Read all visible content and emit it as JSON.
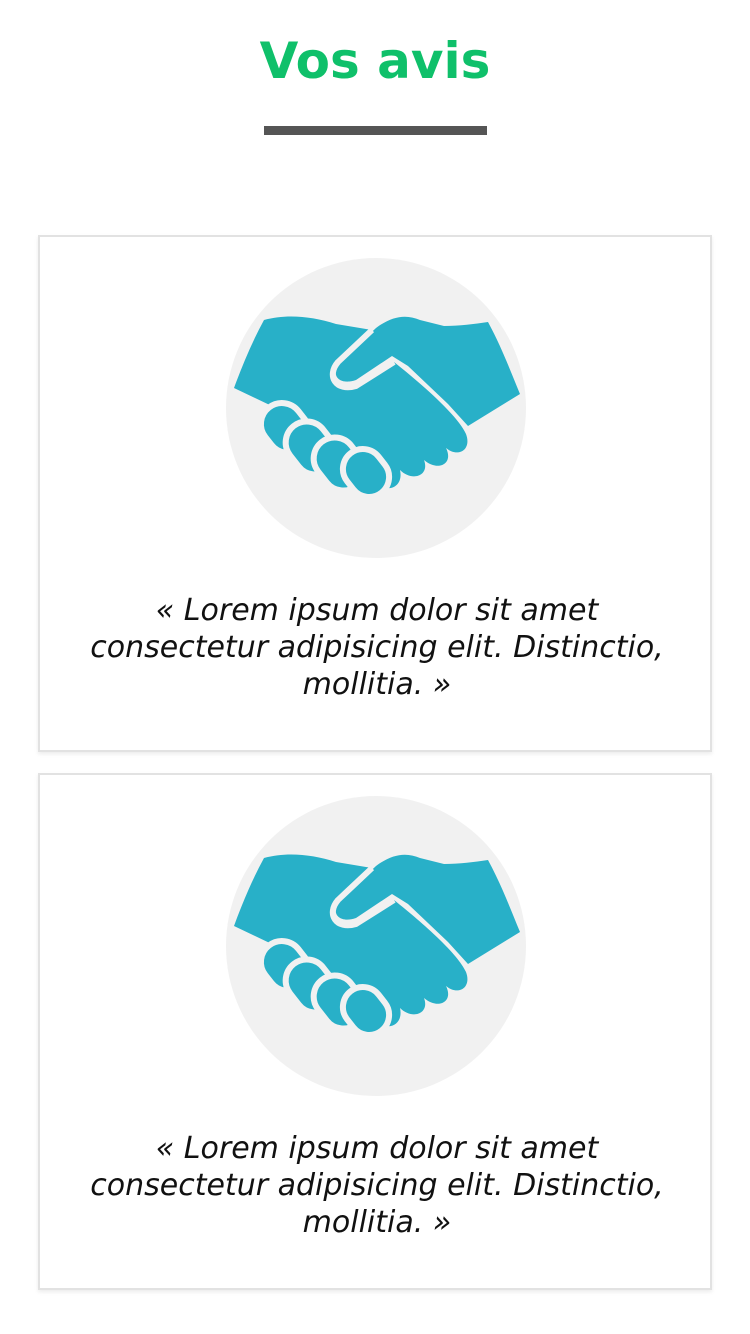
{
  "section": {
    "title": "Vos avis",
    "title_color": "#0fc06a",
    "underline_color": "#555555"
  },
  "icon": {
    "name": "handshake-icon",
    "color": "#28b0c8",
    "background": "#f1f1f1"
  },
  "reviews": [
    {
      "text": "« Lorem ipsum dolor sit amet consectetur adipisicing elit. Distinctio, mollitia. »"
    },
    {
      "text": "« Lorem ipsum dolor sit amet consectetur adipisicing elit. Distinctio, mollitia. »"
    }
  ]
}
